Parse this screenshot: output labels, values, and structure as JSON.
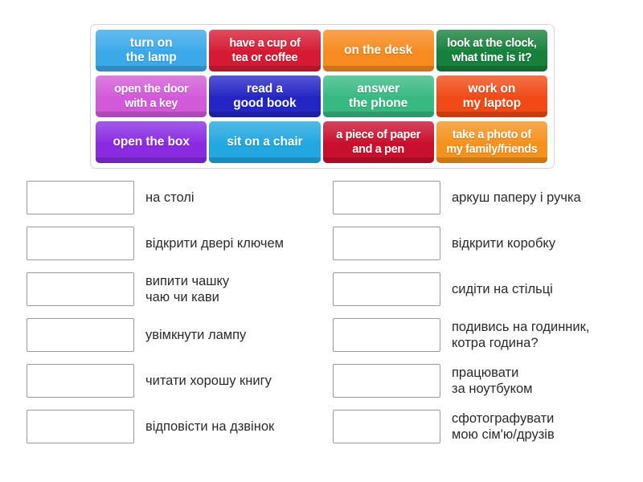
{
  "tile_bank": {
    "rows": [
      [
        {
          "label": "turn on\nthe lamp",
          "color": "#3ba9e8",
          "text_color": "#ffffff"
        },
        {
          "label": "have a cup of\ntea or coffee",
          "color": "#d51b33",
          "text_color": "#ffffff"
        },
        {
          "label": "on the desk",
          "color": "#f68b1f",
          "text_color": "#ffffff"
        },
        {
          "label": "look at the clock,\nwhat time is it?",
          "color": "#17803c",
          "text_color": "#ffffff"
        }
      ],
      [
        {
          "label": "open the door\nwith a key",
          "color": "#d25ad8",
          "text_color": "#ffffff"
        },
        {
          "label": "read a\ngood book",
          "color": "#2326c4",
          "text_color": "#ffffff"
        },
        {
          "label": "answer\nthe phone",
          "color": "#38b982",
          "text_color": "#ffffff"
        },
        {
          "label": "work on\nmy laptop",
          "color": "#f04a16",
          "text_color": "#ffffff"
        }
      ],
      [
        {
          "label": "open the box",
          "color": "#8a2be2",
          "text_color": "#ffffff"
        },
        {
          "label": "sit on a chair",
          "color": "#22a7e0",
          "text_color": "#ffffff"
        },
        {
          "label": "a piece of paper\nand a pen",
          "color": "#c8102e",
          "text_color": "#ffffff"
        },
        {
          "label": "take a photo of\nmy family/friends",
          "color": "#f5921e",
          "text_color": "#ffffff"
        }
      ]
    ]
  },
  "answers": {
    "left": [
      {
        "box_value": "",
        "text": "на столі"
      },
      {
        "box_value": "",
        "text": "відкрити двері ключем"
      },
      {
        "box_value": "",
        "text": "випити чашку\nчаю чи кави"
      },
      {
        "box_value": "",
        "text": "увімкнути лампу"
      },
      {
        "box_value": "",
        "text": "читати хорошу книгу"
      },
      {
        "box_value": "",
        "text": "відповісти на дзвінок"
      }
    ],
    "right": [
      {
        "box_value": "",
        "text": "аркуш паперу і ручка"
      },
      {
        "box_value": "",
        "text": "відкрити коробку"
      },
      {
        "box_value": "",
        "text": "сидіти на стільці"
      },
      {
        "box_value": "",
        "text": "подивись на годинник,\nкотра година?"
      },
      {
        "box_value": "",
        "text": "працювати\nза ноутбуком"
      },
      {
        "box_value": "",
        "text": "сфотографувати\nмою сім'ю/друзів"
      }
    ]
  }
}
